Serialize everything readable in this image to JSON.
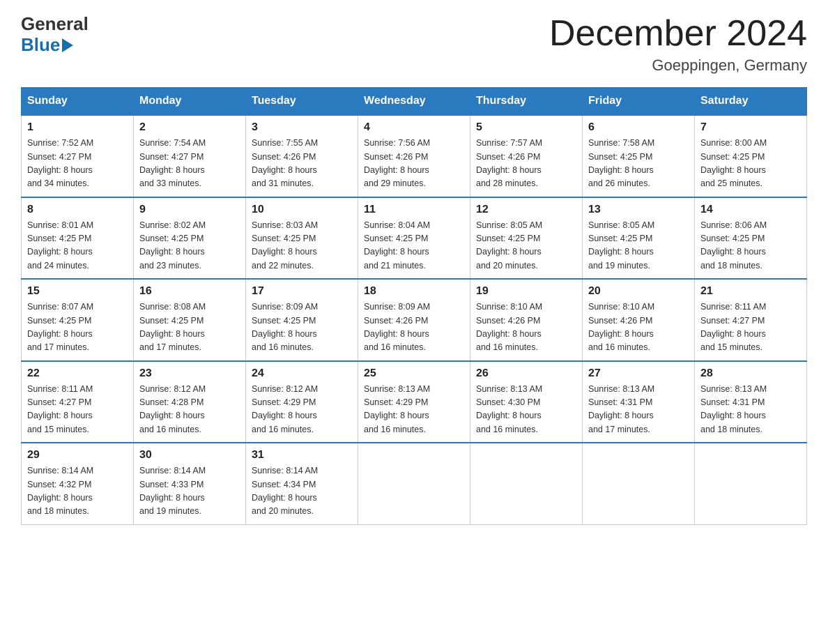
{
  "logo": {
    "line1": "General",
    "line2": "Blue"
  },
  "title": "December 2024",
  "location": "Goeppingen, Germany",
  "days_of_week": [
    "Sunday",
    "Monday",
    "Tuesday",
    "Wednesday",
    "Thursday",
    "Friday",
    "Saturday"
  ],
  "weeks": [
    [
      {
        "day": "1",
        "sunrise": "7:52 AM",
        "sunset": "4:27 PM",
        "daylight": "8 hours and 34 minutes."
      },
      {
        "day": "2",
        "sunrise": "7:54 AM",
        "sunset": "4:27 PM",
        "daylight": "8 hours and 33 minutes."
      },
      {
        "day": "3",
        "sunrise": "7:55 AM",
        "sunset": "4:26 PM",
        "daylight": "8 hours and 31 minutes."
      },
      {
        "day": "4",
        "sunrise": "7:56 AM",
        "sunset": "4:26 PM",
        "daylight": "8 hours and 29 minutes."
      },
      {
        "day": "5",
        "sunrise": "7:57 AM",
        "sunset": "4:26 PM",
        "daylight": "8 hours and 28 minutes."
      },
      {
        "day": "6",
        "sunrise": "7:58 AM",
        "sunset": "4:25 PM",
        "daylight": "8 hours and 26 minutes."
      },
      {
        "day": "7",
        "sunrise": "8:00 AM",
        "sunset": "4:25 PM",
        "daylight": "8 hours and 25 minutes."
      }
    ],
    [
      {
        "day": "8",
        "sunrise": "8:01 AM",
        "sunset": "4:25 PM",
        "daylight": "8 hours and 24 minutes."
      },
      {
        "day": "9",
        "sunrise": "8:02 AM",
        "sunset": "4:25 PM",
        "daylight": "8 hours and 23 minutes."
      },
      {
        "day": "10",
        "sunrise": "8:03 AM",
        "sunset": "4:25 PM",
        "daylight": "8 hours and 22 minutes."
      },
      {
        "day": "11",
        "sunrise": "8:04 AM",
        "sunset": "4:25 PM",
        "daylight": "8 hours and 21 minutes."
      },
      {
        "day": "12",
        "sunrise": "8:05 AM",
        "sunset": "4:25 PM",
        "daylight": "8 hours and 20 minutes."
      },
      {
        "day": "13",
        "sunrise": "8:05 AM",
        "sunset": "4:25 PM",
        "daylight": "8 hours and 19 minutes."
      },
      {
        "day": "14",
        "sunrise": "8:06 AM",
        "sunset": "4:25 PM",
        "daylight": "8 hours and 18 minutes."
      }
    ],
    [
      {
        "day": "15",
        "sunrise": "8:07 AM",
        "sunset": "4:25 PM",
        "daylight": "8 hours and 17 minutes."
      },
      {
        "day": "16",
        "sunrise": "8:08 AM",
        "sunset": "4:25 PM",
        "daylight": "8 hours and 17 minutes."
      },
      {
        "day": "17",
        "sunrise": "8:09 AM",
        "sunset": "4:25 PM",
        "daylight": "8 hours and 16 minutes."
      },
      {
        "day": "18",
        "sunrise": "8:09 AM",
        "sunset": "4:26 PM",
        "daylight": "8 hours and 16 minutes."
      },
      {
        "day": "19",
        "sunrise": "8:10 AM",
        "sunset": "4:26 PM",
        "daylight": "8 hours and 16 minutes."
      },
      {
        "day": "20",
        "sunrise": "8:10 AM",
        "sunset": "4:26 PM",
        "daylight": "8 hours and 16 minutes."
      },
      {
        "day": "21",
        "sunrise": "8:11 AM",
        "sunset": "4:27 PM",
        "daylight": "8 hours and 15 minutes."
      }
    ],
    [
      {
        "day": "22",
        "sunrise": "8:11 AM",
        "sunset": "4:27 PM",
        "daylight": "8 hours and 15 minutes."
      },
      {
        "day": "23",
        "sunrise": "8:12 AM",
        "sunset": "4:28 PM",
        "daylight": "8 hours and 16 minutes."
      },
      {
        "day": "24",
        "sunrise": "8:12 AM",
        "sunset": "4:29 PM",
        "daylight": "8 hours and 16 minutes."
      },
      {
        "day": "25",
        "sunrise": "8:13 AM",
        "sunset": "4:29 PM",
        "daylight": "8 hours and 16 minutes."
      },
      {
        "day": "26",
        "sunrise": "8:13 AM",
        "sunset": "4:30 PM",
        "daylight": "8 hours and 16 minutes."
      },
      {
        "day": "27",
        "sunrise": "8:13 AM",
        "sunset": "4:31 PM",
        "daylight": "8 hours and 17 minutes."
      },
      {
        "day": "28",
        "sunrise": "8:13 AM",
        "sunset": "4:31 PM",
        "daylight": "8 hours and 18 minutes."
      }
    ],
    [
      {
        "day": "29",
        "sunrise": "8:14 AM",
        "sunset": "4:32 PM",
        "daylight": "8 hours and 18 minutes."
      },
      {
        "day": "30",
        "sunrise": "8:14 AM",
        "sunset": "4:33 PM",
        "daylight": "8 hours and 19 minutes."
      },
      {
        "day": "31",
        "sunrise": "8:14 AM",
        "sunset": "4:34 PM",
        "daylight": "8 hours and 20 minutes."
      },
      null,
      null,
      null,
      null
    ]
  ],
  "labels": {
    "sunrise": "Sunrise:",
    "sunset": "Sunset:",
    "daylight": "Daylight:"
  }
}
